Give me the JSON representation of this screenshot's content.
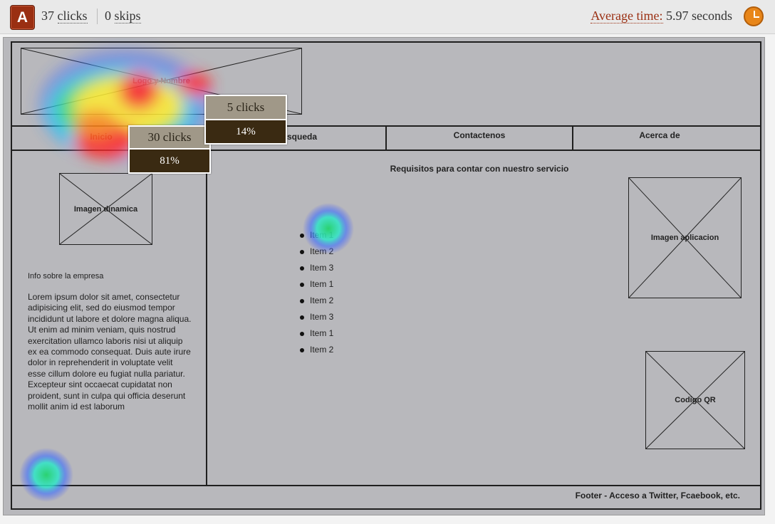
{
  "header": {
    "badge": "A",
    "clicks_count": "37",
    "clicks_label": "clicks",
    "skips_count": "0",
    "skips_label": "skips",
    "avg_label": "Average time:",
    "avg_value": "5.97 seconds"
  },
  "wireframe": {
    "logo": "Logo y Nombre",
    "nav": [
      "Inicio",
      "Busqueda",
      "Contactenos",
      "Acerca de"
    ],
    "dynamic_image": "Imagen dinamica",
    "info_title": "Info sobre la empresa",
    "lorem": "Lorem ipsum dolor sit amet, consectetur adipisicing elit, sed do eiusmod tempor incididunt ut labore et dolore magna aliqua. Ut enim ad minim veniam, quis nostrud exercitation ullamco laboris nisi ut aliquip ex ea commodo consequat. Duis aute irure dolor in reprehenderit in voluptate velit esse cillum dolore eu fugiat nulla pariatur. Excepteur sint occaecat cupidatat non proident, sunt in culpa qui officia deserunt mollit anim id est laborum",
    "main_title": "Requisitos para contar con nuestro servicio",
    "items": [
      "Item 1",
      "Item 2",
      "Item 3",
      "Item 1",
      "Item 2",
      "Item 3",
      "Item 1",
      "Item 2"
    ],
    "app_image": "Imagen aplicacion",
    "qr": "Codigo QR",
    "footer": "Footer - Acceso a Twitter, Fcaebook, etc."
  },
  "tooltips": [
    {
      "clicks": "30 clicks",
      "percent": "81%"
    },
    {
      "clicks": "5 clicks",
      "percent": "14%"
    }
  ],
  "colors": {
    "accent": "#9a2f12",
    "timer": "#e8861a",
    "tooltip_bottom": "#3a2a12"
  }
}
